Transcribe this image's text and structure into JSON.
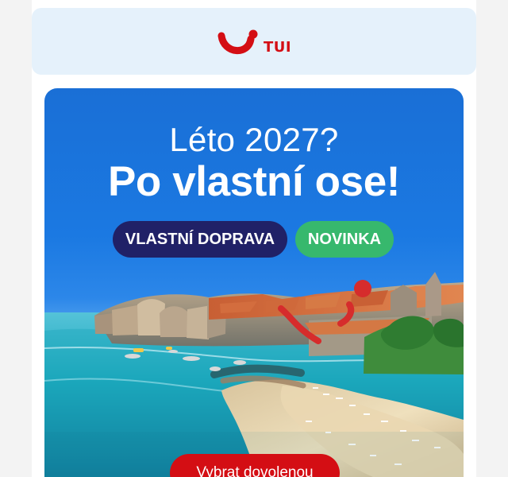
{
  "brand": {
    "name": "TUI",
    "logo_icon": "tui-smile-logo",
    "primary_color": "#d40e14",
    "header_background": "#e5f1fb"
  },
  "hero": {
    "headline_small": "Léto 2027?",
    "headline_large": "Po vlastní ose!",
    "badges": [
      {
        "label": "VLASTNÍ DOPRAVA",
        "color": "#202167"
      },
      {
        "label": "NOVINKA",
        "color": "#37b86d"
      }
    ],
    "cta_label": "Vybrat dovolenou"
  }
}
